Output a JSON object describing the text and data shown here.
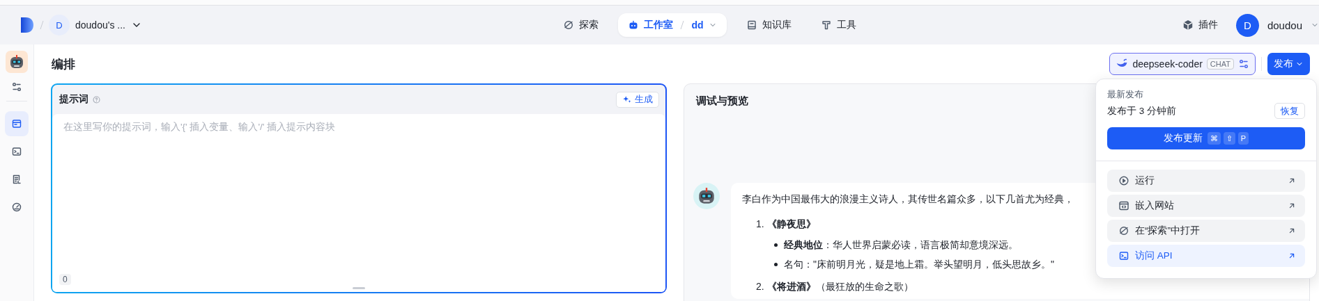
{
  "top_bar": {
    "workspace": {
      "avatar": "D",
      "name": "doudou's ..."
    },
    "nav": [
      {
        "label": "探索",
        "selected": false
      },
      {
        "label": "工作室",
        "sub": "dd",
        "selected": true
      },
      {
        "label": "知识库",
        "selected": false
      },
      {
        "label": "工具",
        "selected": false
      }
    ],
    "plugins": "插件",
    "user": {
      "avatar": "D",
      "name": "doudou"
    }
  },
  "sidebar": {
    "items": [
      {
        "selected": true
      },
      {
        "selected": false
      },
      {
        "selected": false
      },
      {
        "selected": false
      }
    ]
  },
  "header": {
    "title": "编排",
    "model": {
      "name": "deepseek-coder",
      "tag": "CHAT"
    },
    "publish_button": "发布"
  },
  "prompt": {
    "label": "提示词",
    "generate_button": "生成",
    "placeholder": "在这里写你的提示词，输入'{' 插入变量、输入'/' 插入提示内容块",
    "count": "0"
  },
  "preview": {
    "title": "调试与预览",
    "message": {
      "intro": "李白作为中国最伟大的浪漫主义诗人，其传世名篇众多，以下几首尤为经典，",
      "items": [
        {
          "number": "1.",
          "title": "《静夜思》",
          "bullets": [
            "**经典地位**：华人世界启蒙必读，语言极简却意境深远。",
            "名句：\"床前明月光，疑是地上霜。举头望明月，低头思故乡。\""
          ]
        },
        {
          "number": "2.",
          "title": "《将进酒》",
          "note": "（最狂放的生命之歌）"
        }
      ]
    }
  },
  "publish_menu": {
    "section_label": "最新发布",
    "published": "发布于 3 分钟前",
    "restore_button": "恢复",
    "update_button": "发布更新",
    "shortcut": [
      "⌘",
      "⇧",
      "P"
    ],
    "items": [
      {
        "label": "运行",
        "selected": false
      },
      {
        "label": "嵌入网站",
        "selected": false
      },
      {
        "label": "在“探索”中打开",
        "selected": false
      },
      {
        "label": "访问 API",
        "selected": true
      }
    ]
  }
}
